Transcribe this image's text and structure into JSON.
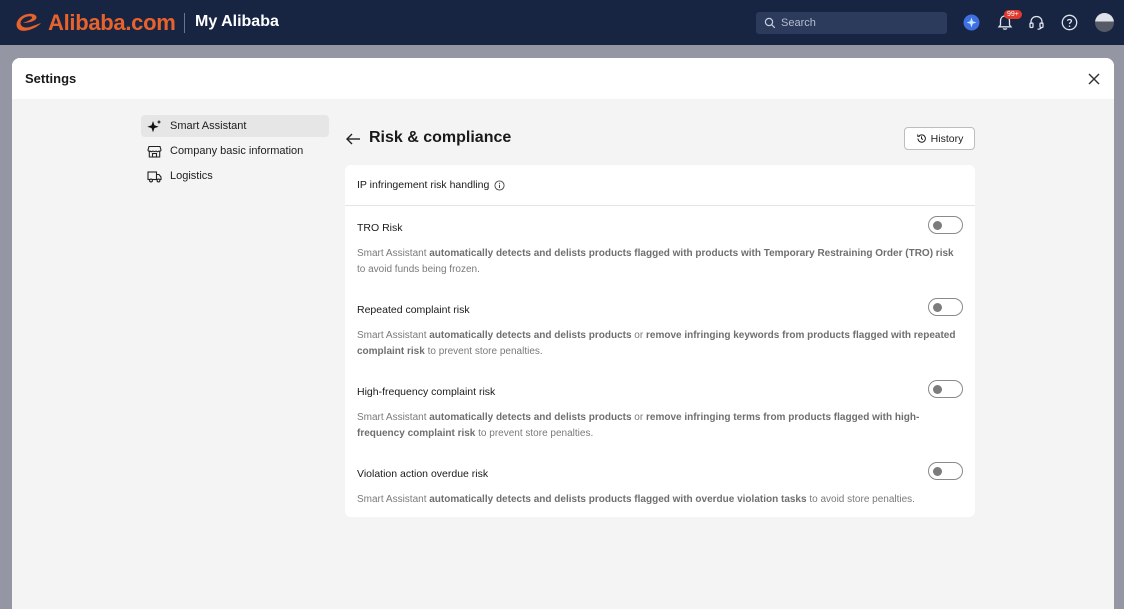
{
  "brand": {
    "logo_text": "Alibaba.com",
    "product": "My Alibaba",
    "accent": "#e8632c",
    "nav_bg": "#172442"
  },
  "search": {
    "placeholder": "Search"
  },
  "notifications": {
    "badge": "99+"
  },
  "modal": {
    "title": "Settings"
  },
  "sidebar": {
    "items": [
      {
        "label": "Smart Assistant",
        "icon": "sparkle-icon",
        "active": true
      },
      {
        "label": "Company basic information",
        "icon": "storefront-icon",
        "active": false
      },
      {
        "label": "Logistics",
        "icon": "truck-icon",
        "active": false
      }
    ]
  },
  "main": {
    "title": "Risk & compliance",
    "history_label": "History",
    "section_title": "IP infringement risk handling",
    "risks": [
      {
        "title": "TRO Risk",
        "enabled": false,
        "desc": [
          {
            "t": "Smart Assistant ",
            "b": false
          },
          {
            "t": "automatically detects and delists products flagged with products with Temporary Restraining Order (TRO) risk",
            "b": true
          },
          {
            "t": " to avoid funds being frozen.",
            "b": false
          }
        ]
      },
      {
        "title": "Repeated complaint risk",
        "enabled": false,
        "desc": [
          {
            "t": "Smart Assistant ",
            "b": false
          },
          {
            "t": "automatically detects and delists products",
            "b": true
          },
          {
            "t": " or ",
            "b": false
          },
          {
            "t": "remove infringing keywords from products flagged with repeated complaint risk",
            "b": true
          },
          {
            "t": " to prevent store penalties.",
            "b": false
          }
        ]
      },
      {
        "title": "High-frequency complaint risk",
        "enabled": false,
        "desc": [
          {
            "t": "Smart Assistant ",
            "b": false
          },
          {
            "t": "automatically detects and delists products",
            "b": true
          },
          {
            "t": " or ",
            "b": false
          },
          {
            "t": "remove infringing terms from products flagged with high-frequency complaint risk",
            "b": true
          },
          {
            "t": " to prevent store penalties.",
            "b": false
          }
        ]
      },
      {
        "title": "Violation action overdue risk",
        "enabled": false,
        "desc": [
          {
            "t": "Smart Assistant ",
            "b": false
          },
          {
            "t": "automatically detects and delists products flagged with overdue violation tasks",
            "b": true
          },
          {
            "t": " to avoid store penalties.",
            "b": false
          }
        ]
      }
    ]
  }
}
